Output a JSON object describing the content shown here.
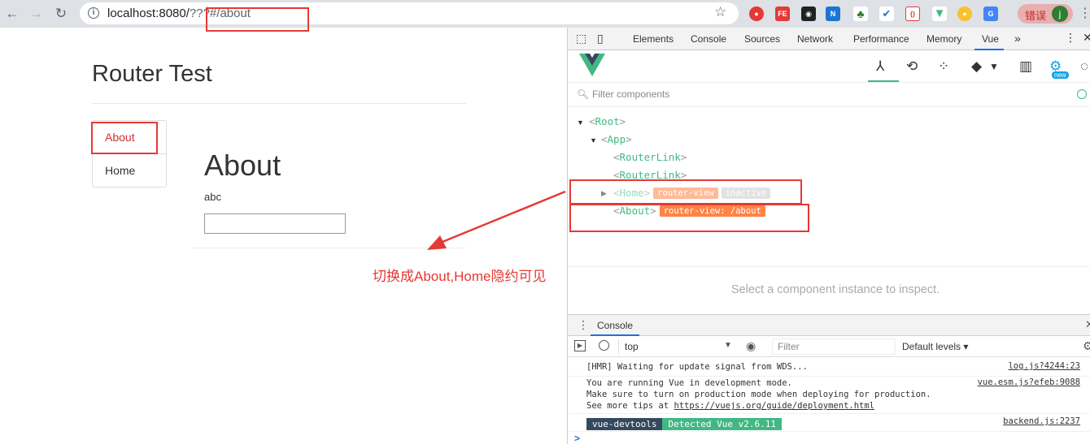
{
  "browser": {
    "url_host": "localhost:8080/",
    "url_path": "???#/about",
    "error_label": "错误",
    "profile_initial": "j"
  },
  "page": {
    "title": "Router Test",
    "nav_links": [
      "About",
      "Home"
    ],
    "heading": "About",
    "text": "abc",
    "input_value": ""
  },
  "annotation": {
    "note": "切换成About,Home隐约可见",
    "color": "#e53935"
  },
  "devtools": {
    "tabs": [
      "Elements",
      "Console",
      "Sources",
      "Network",
      "Performance",
      "Memory",
      "Vue"
    ],
    "active_tab": "Vue",
    "more": "»",
    "filter_placeholder": "Filter components",
    "tree": {
      "root": "Root",
      "app": "App",
      "router_link_1": "RouterLink",
      "router_link_2": "RouterLink",
      "home": "Home",
      "home_tag": "router-view",
      "home_state": "inactive",
      "about": "About",
      "about_tag": "router-view: /about"
    },
    "inspect_hint": "Select a component instance to inspect.",
    "new_badge": "new",
    "drawer_tab": "Console",
    "console": {
      "context": "top",
      "filter_placeholder": "Filter",
      "levels": "Default levels ▾",
      "logs": [
        {
          "text": "[HMR] Waiting for update signal from WDS...",
          "src": "log.js?4244:23"
        },
        {
          "line1": "You are running Vue in development mode.",
          "line2": "Make sure to turn on production mode when deploying for production.",
          "line3_prefix": "See more tips at ",
          "line3_link": "https://vuejs.org/guide/deployment.html",
          "src": "vue.esm.js?efeb:9088"
        },
        {
          "badge1": "vue-devtools",
          "badge2": "Detected Vue v2.6.11",
          "src": "backend.js:2237"
        }
      ],
      "prompt": ">"
    }
  },
  "colors": {
    "vue_green": "#41b883",
    "vue_dark": "#35495e",
    "router_view_orange": "#ff8344",
    "active_link_red": "#d32f2f"
  }
}
